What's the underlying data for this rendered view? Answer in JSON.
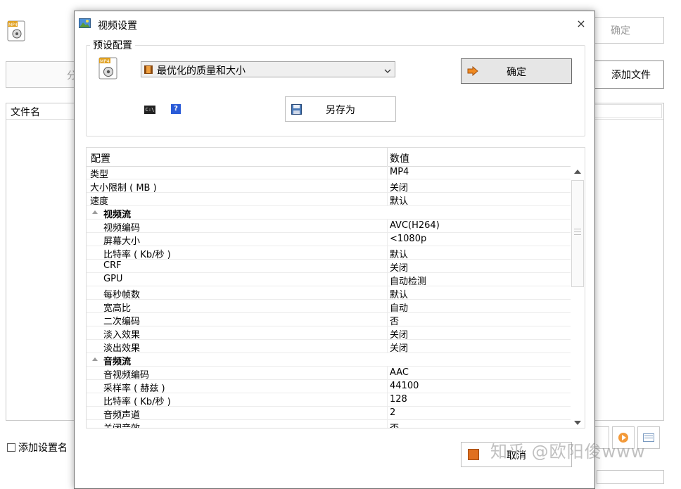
{
  "background": {
    "ok_label": "确定",
    "toolbar_label": "分",
    "add_files_label": "添加文件",
    "file_list_header": "文件名",
    "add_settings_label": "添加设置名"
  },
  "dialog": {
    "title": "视频设置",
    "close_label": "×",
    "preset_group_label": "预设配置",
    "preset_value": "最优化的质量和大小",
    "ok_label": "确定",
    "help_label": "?",
    "cmd_label": "C:\\",
    "save_as_label": "另存为",
    "cancel_label": "取消",
    "grid": {
      "header_config": "配置",
      "header_value": "数值",
      "rows": [
        {
          "key": "类型",
          "value": "MP4",
          "level": 0
        },
        {
          "key": "大小限制 ( MB )",
          "value": "关闭",
          "level": 0
        },
        {
          "key": "速度",
          "value": "默认",
          "level": 0
        },
        {
          "key": "视频流",
          "value": "",
          "level": 0,
          "category": true
        },
        {
          "key": "视频编码",
          "value": "AVC(H264)",
          "level": 1
        },
        {
          "key": "屏幕大小",
          "value": "<1080p",
          "level": 1
        },
        {
          "key": "比特率 ( Kb/秒 )",
          "value": "默认",
          "level": 1
        },
        {
          "key": "CRF",
          "value": "关闭",
          "level": 1
        },
        {
          "key": "GPU",
          "value": "自动检测",
          "level": 1
        },
        {
          "key": "每秒帧数",
          "value": "默认",
          "level": 1
        },
        {
          "key": "宽高比",
          "value": "自动",
          "level": 1
        },
        {
          "key": "二次编码",
          "value": "否",
          "level": 1
        },
        {
          "key": "淡入效果",
          "value": "关闭",
          "level": 1
        },
        {
          "key": "淡出效果",
          "value": "关闭",
          "level": 1
        },
        {
          "key": "音频流",
          "value": "",
          "level": 0,
          "category": true
        },
        {
          "key": "音视频编码",
          "value": "AAC",
          "level": 1
        },
        {
          "key": "采样率 ( 赫兹 )",
          "value": "44100",
          "level": 1
        },
        {
          "key": "比特率 ( Kb/秒 )",
          "value": "128",
          "level": 1
        },
        {
          "key": "音频声道",
          "value": "2",
          "level": 1
        },
        {
          "key": "关闭音效",
          "value": "否",
          "level": 1
        }
      ]
    }
  },
  "watermark": "知乎 @欧阳俊www",
  "colors": {
    "accent_orange": "#e07020",
    "help_blue": "#2a5bd7"
  }
}
